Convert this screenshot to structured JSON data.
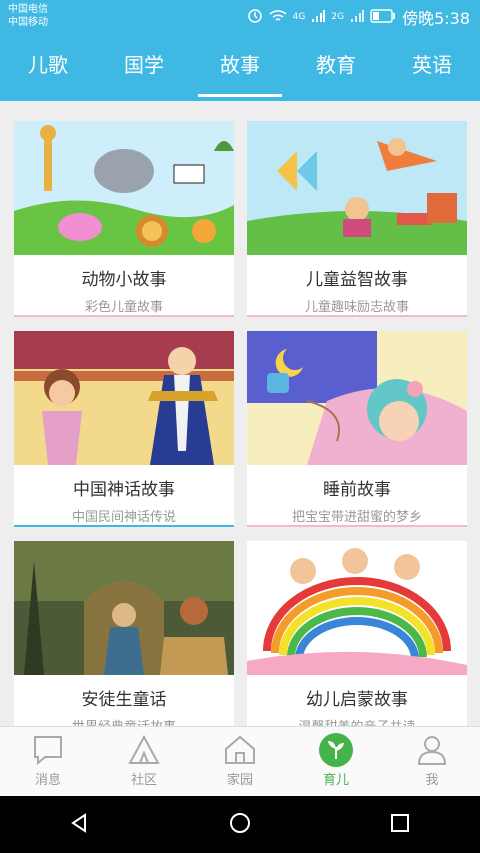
{
  "status": {
    "carrier1": "中国电信",
    "carrier2": "中国移动",
    "network1": "4G",
    "network2": "2G",
    "time": "傍晚5:38"
  },
  "tabs": [
    {
      "label": "儿歌"
    },
    {
      "label": "国学"
    },
    {
      "label": "故事",
      "active": true
    },
    {
      "label": "教育"
    },
    {
      "label": "英语"
    }
  ],
  "cards": [
    {
      "title": "动物小故事",
      "subtitle": "彩色儿童故事"
    },
    {
      "title": "儿童益智故事",
      "subtitle": "儿童趣味励志故事"
    },
    {
      "title": "中国神话故事",
      "subtitle": "中国民间神话传说"
    },
    {
      "title": "睡前故事",
      "subtitle": "把宝宝带进甜蜜的梦乡"
    },
    {
      "title": "安徒生童话",
      "subtitle": "世界经典童话故事"
    },
    {
      "title": "幼儿启蒙故事",
      "subtitle": "温馨甜美的亲子共读"
    }
  ],
  "bottom_nav": [
    {
      "label": "消息",
      "icon": "chat-bubble-icon"
    },
    {
      "label": "社区",
      "icon": "tent-icon"
    },
    {
      "label": "家园",
      "icon": "house-icon"
    },
    {
      "label": "育儿",
      "icon": "sprout-icon",
      "active": true
    },
    {
      "label": "我",
      "icon": "person-icon"
    }
  ],
  "colors": {
    "primary": "#3fb8e3",
    "active_nav": "#45b34a",
    "card_border": "#f3b8c9"
  }
}
